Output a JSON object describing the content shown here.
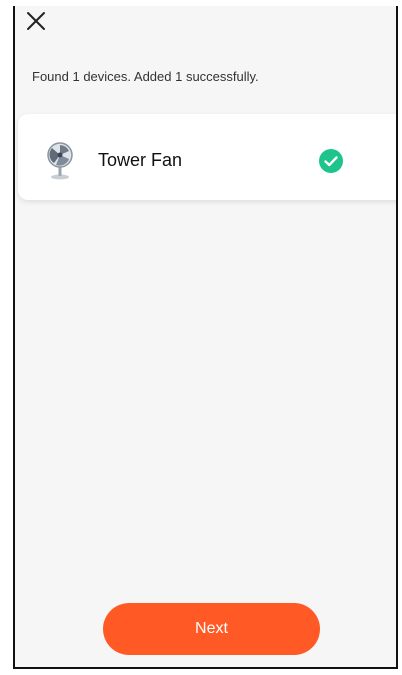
{
  "header": {
    "close_icon": "close-icon"
  },
  "status": {
    "text": "Found 1 devices. Added 1 successfully."
  },
  "devices": [
    {
      "name": "Tower Fan",
      "icon": "fan-icon",
      "status_icon": "check-circle-icon",
      "status_color": "#1ec48b"
    }
  ],
  "footer": {
    "next_label": "Next"
  },
  "colors": {
    "accent": "#ff5a26",
    "background": "#f6f6f6",
    "card": "#ffffff",
    "success": "#1ec48b"
  }
}
